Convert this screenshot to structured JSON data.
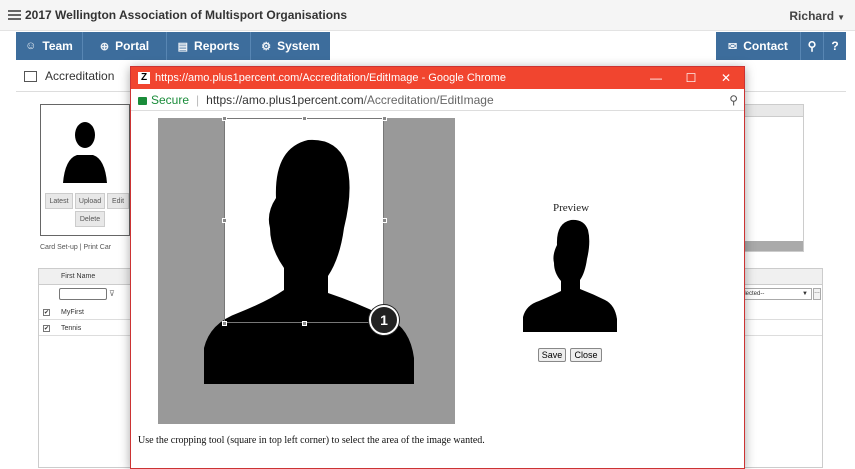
{
  "app": {
    "title": "2017 Wellington Association of Multisport Organisations",
    "user": "Richard"
  },
  "nav": {
    "team": "Team",
    "portal": "Portal",
    "reports": "Reports",
    "system": "System",
    "contact": "Contact"
  },
  "page": {
    "tab": "Accreditation",
    "card_buttons": [
      "Latest",
      "Upload",
      "Edit",
      "Delete"
    ],
    "card_links": [
      "Card Set-up",
      "Print Car"
    ],
    "grid_header": "First Name",
    "grid_select": "elected--",
    "rows": [
      "MyFirst",
      "Tennis"
    ]
  },
  "popup": {
    "window_title": "https://amo.plus1percent.com/Accreditation/EditImage - Google Chrome",
    "secure_label": "Secure",
    "url_host": "https://amo.plus1percent.com",
    "url_path": "/Accreditation/EditImage",
    "preview_label": "Preview",
    "save_label": "Save",
    "close_label": "Close",
    "instructions": "Use the cropping tool (square in top left corner) to select the area of the image wanted.",
    "callout_number": "1"
  }
}
